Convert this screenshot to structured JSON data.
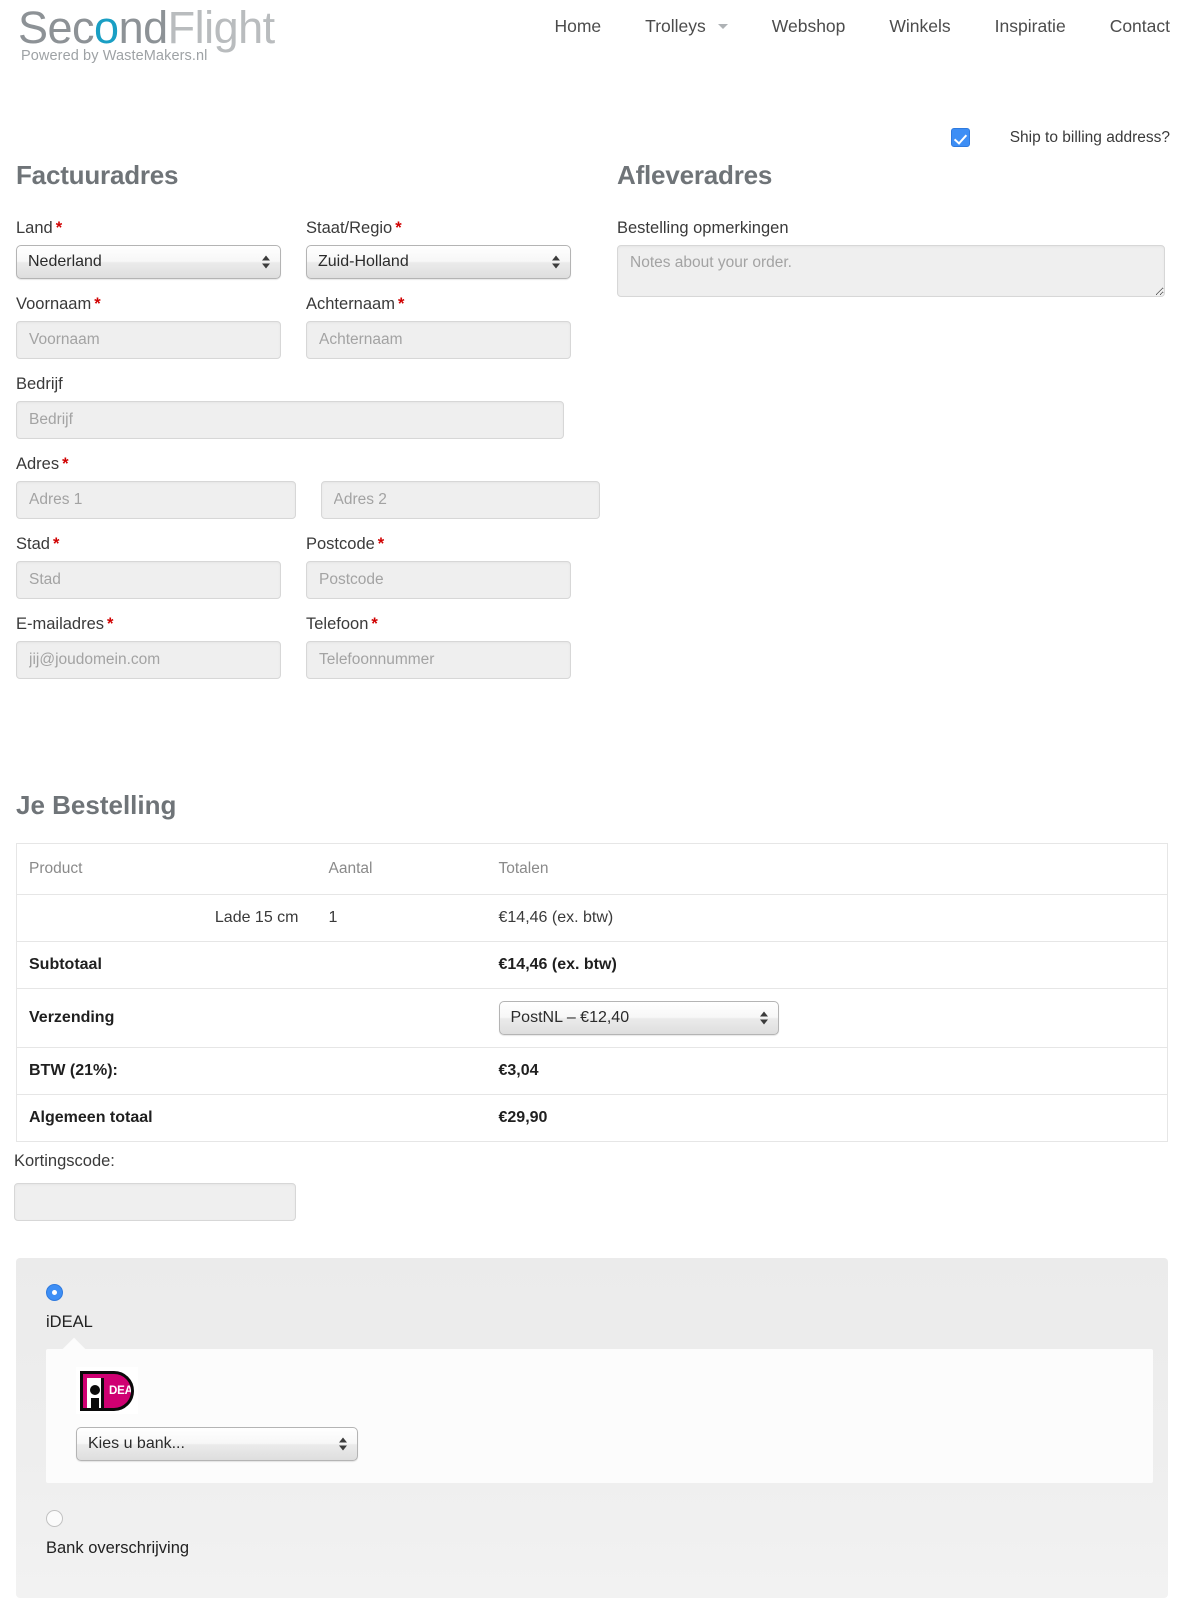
{
  "header": {
    "logo": {
      "part1": "Sec",
      "part2": "o",
      "part3": "nd",
      "part4": "Flight",
      "tagline": "Powered by WasteMakers.nl"
    },
    "nav": [
      {
        "label": "Home",
        "has_caret": false
      },
      {
        "label": "Trolleys",
        "has_caret": true
      },
      {
        "label": "Webshop",
        "has_caret": false
      },
      {
        "label": "Winkels",
        "has_caret": false
      },
      {
        "label": "Inspiratie",
        "has_caret": false
      },
      {
        "label": "Contact",
        "has_caret": false
      }
    ]
  },
  "ship_to_billing": {
    "label": "Ship to billing address?",
    "checked": true
  },
  "billing": {
    "title": "Factuuradres",
    "country": {
      "label": "Land",
      "required": true,
      "value": "Nederland"
    },
    "state": {
      "label": "Staat/Regio",
      "required": true,
      "value": "Zuid-Holland"
    },
    "first_name": {
      "label": "Voornaam",
      "required": true,
      "value": "",
      "placeholder": "Voornaam"
    },
    "last_name": {
      "label": "Achternaam",
      "required": true,
      "value": "",
      "placeholder": "Achternaam"
    },
    "company": {
      "label": "Bedrijf",
      "required": false,
      "value": "",
      "placeholder": "Bedrijf"
    },
    "address": {
      "label": "Adres",
      "required": true
    },
    "address1": {
      "value": "",
      "placeholder": "Adres 1"
    },
    "address2": {
      "value": "",
      "placeholder": "Adres 2"
    },
    "city": {
      "label": "Stad",
      "required": true,
      "value": "",
      "placeholder": "Stad"
    },
    "postcode": {
      "label": "Postcode",
      "required": true,
      "value": "",
      "placeholder": "Postcode"
    },
    "email": {
      "label": "E-mailadres",
      "required": true,
      "value": "",
      "placeholder": "jij@joudomein.com"
    },
    "phone": {
      "label": "Telefoon",
      "required": true,
      "value": "",
      "placeholder": "Telefoonnummer"
    }
  },
  "shipping_section": {
    "title": "Afleveradres",
    "notes_label": "Bestelling opmerkingen",
    "notes_value": "",
    "notes_placeholder": "Notes about your order."
  },
  "order": {
    "title": "Je Bestelling",
    "columns": [
      "Product",
      "Aantal",
      "Totalen"
    ],
    "items": [
      {
        "name": "Lade 15 cm",
        "qty": "1",
        "total": "€14,46 (ex. btw)"
      }
    ],
    "subtotal": {
      "label": "Subtotaal",
      "value": "€14,46 (ex. btw)"
    },
    "shipping": {
      "label": "Verzending",
      "value": "PostNL – €12,40"
    },
    "tax": {
      "label": "BTW (21%):",
      "value": "€3,04"
    },
    "grand_total": {
      "label": "Algemeen totaal",
      "value": "€29,90"
    }
  },
  "coupon": {
    "label": "Kortingscode:",
    "value": "",
    "placeholder": ""
  },
  "payment": {
    "methods": [
      {
        "name": "iDEAL",
        "selected": true
      },
      {
        "name": "Bank overschrijving",
        "selected": false
      }
    ],
    "ideal": {
      "logo_text": "DEAL",
      "bank_select_value": "Kies u bank..."
    }
  },
  "colors": {
    "accent_blue": "#3d8ef5",
    "logo_teal": "#1a9fc4",
    "logo_gray": "#8d9296",
    "required_red": "#d00000",
    "ideal_magenta": "#cf0072"
  }
}
